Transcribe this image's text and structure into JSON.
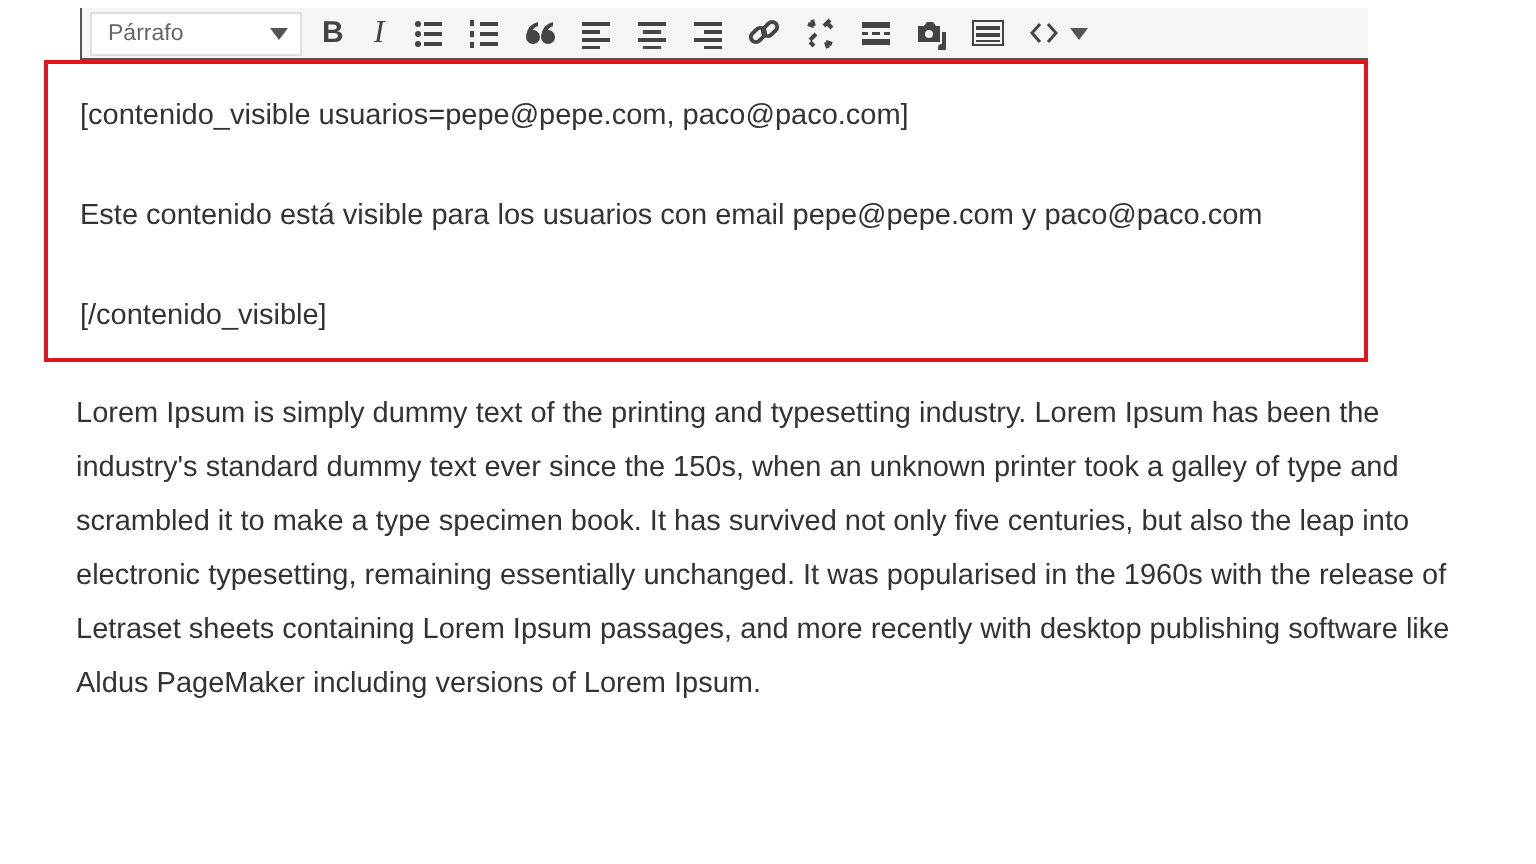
{
  "toolbar": {
    "format_select": "Párrafo",
    "buttons": [
      {
        "kind": "bold",
        "label": "B"
      },
      {
        "kind": "italic",
        "label": "I"
      },
      {
        "kind": "bullet-list"
      },
      {
        "kind": "numbered-list"
      },
      {
        "kind": "quote"
      },
      {
        "kind": "align-left"
      },
      {
        "kind": "align-center"
      },
      {
        "kind": "align-right"
      },
      {
        "kind": "link"
      },
      {
        "kind": "unlink"
      },
      {
        "kind": "more"
      },
      {
        "kind": "media"
      },
      {
        "kind": "toolbar-toggle"
      },
      {
        "kind": "code"
      }
    ]
  },
  "highlighted_block": [
    "[contenido_visible usuarios=pepe@pepe.com, paco@paco.com]",
    "Este contenido está visible para los usuarios con email pepe@pepe.com y paco@paco.com",
    "[/contenido_visible]"
  ],
  "body_text": "Lorem Ipsum is simply dummy text of the printing and typesetting industry. Lorem Ipsum has been the industry's standard dummy text ever since the 150s, when an unknown printer took a galley of type and scrambled it to make a type specimen book. It has survived not only five centuries, but also the leap into electronic typesetting, remaining essentially unchanged. It was popularised in the 1960s with the release of Letraset sheets containing Lorem Ipsum passages, and more recently with desktop publishing software like Aldus PageMaker including versions of Lorem Ipsum."
}
